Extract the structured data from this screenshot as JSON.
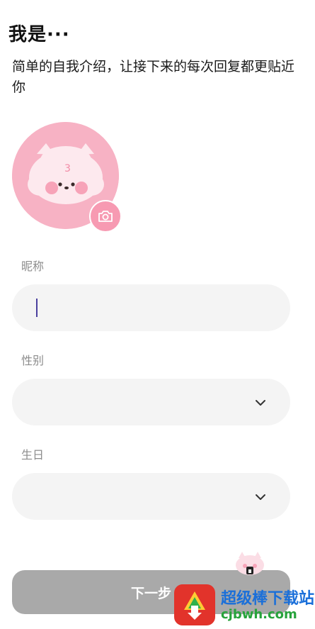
{
  "header": {
    "title": "我是···",
    "subtitle": "简单的自我介绍，让接下来的每次回复都更贴近你"
  },
  "avatar": {
    "bg_color": "#f7b2c4",
    "camera_icon": "camera-icon"
  },
  "form": {
    "nickname": {
      "label": "昵称",
      "value": "",
      "placeholder": ""
    },
    "gender": {
      "label": "性别",
      "value": ""
    },
    "birthday": {
      "label": "生日",
      "value": ""
    }
  },
  "actions": {
    "next_label": "下一步"
  },
  "watermark": {
    "title": "超级棒下载站",
    "site": "cjbwh.com"
  },
  "colors": {
    "field_bg": "#f4f4f4",
    "button_disabled": "#a9a9a9",
    "caret": "#4a3f9e",
    "accent_pink": "#f79ab2"
  }
}
